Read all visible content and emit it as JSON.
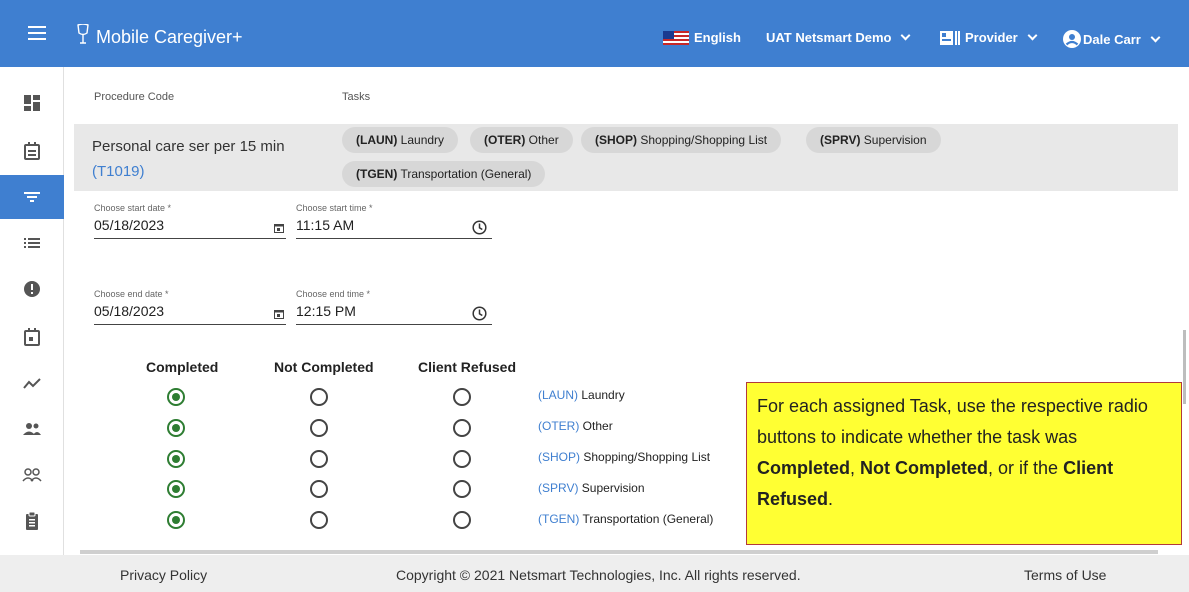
{
  "header": {
    "app_title": "Mobile Caregiver+",
    "language": "English",
    "agency": "UAT Netsmart Demo",
    "role": "Provider",
    "user": "Dale Carr",
    "bg_color": "#3f7fd0"
  },
  "sidebar": {
    "items": [
      {
        "icon": "dashboard-icon"
      },
      {
        "icon": "calendar-note-icon"
      },
      {
        "icon": "filter-icon",
        "active": true
      },
      {
        "icon": "list-icon"
      },
      {
        "icon": "alert-icon"
      },
      {
        "icon": "event-icon"
      },
      {
        "icon": "trending-icon"
      },
      {
        "icon": "group-icon"
      },
      {
        "icon": "people-outline-icon"
      },
      {
        "icon": "clipboard-icon"
      }
    ]
  },
  "main": {
    "procedure_code_header": "Procedure Code",
    "tasks_header": "Tasks",
    "procedure_name": "Personal care ser per 15 min",
    "procedure_code": "(T1019)",
    "task_chips": [
      {
        "code": "(LAUN)",
        "name": "Laundry"
      },
      {
        "code": "(OTER)",
        "name": "Other"
      },
      {
        "code": "(SHOP)",
        "name": "Shopping/Shopping List"
      },
      {
        "code": "(SPRV)",
        "name": "Supervision"
      },
      {
        "code": "(TGEN)",
        "name": "Transportation (General)"
      }
    ],
    "start_date": {
      "label": "Choose start date *",
      "value": "05/18/2023"
    },
    "start_time": {
      "label": "Choose start time *",
      "value": "11:15 AM"
    },
    "end_date": {
      "label": "Choose end date *",
      "value": "05/18/2023"
    },
    "end_time": {
      "label": "Choose end time *",
      "value": "12:15 PM"
    },
    "status_columns": [
      "Completed",
      "Not Completed",
      "Client Refused"
    ],
    "task_status": [
      {
        "code": "(LAUN)",
        "name": "Laundry",
        "selected": "Completed"
      },
      {
        "code": "(OTER)",
        "name": "Other",
        "selected": "Completed"
      },
      {
        "code": "(SHOP)",
        "name": "Shopping/Shopping List",
        "selected": "Completed"
      },
      {
        "code": "(SPRV)",
        "name": "Supervision",
        "selected": "Completed"
      },
      {
        "code": "(TGEN)",
        "name": "Transportation (General)",
        "selected": "Completed"
      }
    ]
  },
  "callout": {
    "text_1": "For each assigned Task, use the respective radio buttons to indicate whether the task was ",
    "bold_1": "Completed",
    "text_2": ", ",
    "bold_2": "Not Completed",
    "text_3": ", or if the ",
    "bold_3": "Client Refused",
    "text_4": ".",
    "bg_color": "#ffff33"
  },
  "footer": {
    "privacy": "Privacy Policy",
    "copyright": "Copyright © 2021 Netsmart Technologies, Inc. All rights reserved.",
    "terms": "Terms of Use"
  }
}
